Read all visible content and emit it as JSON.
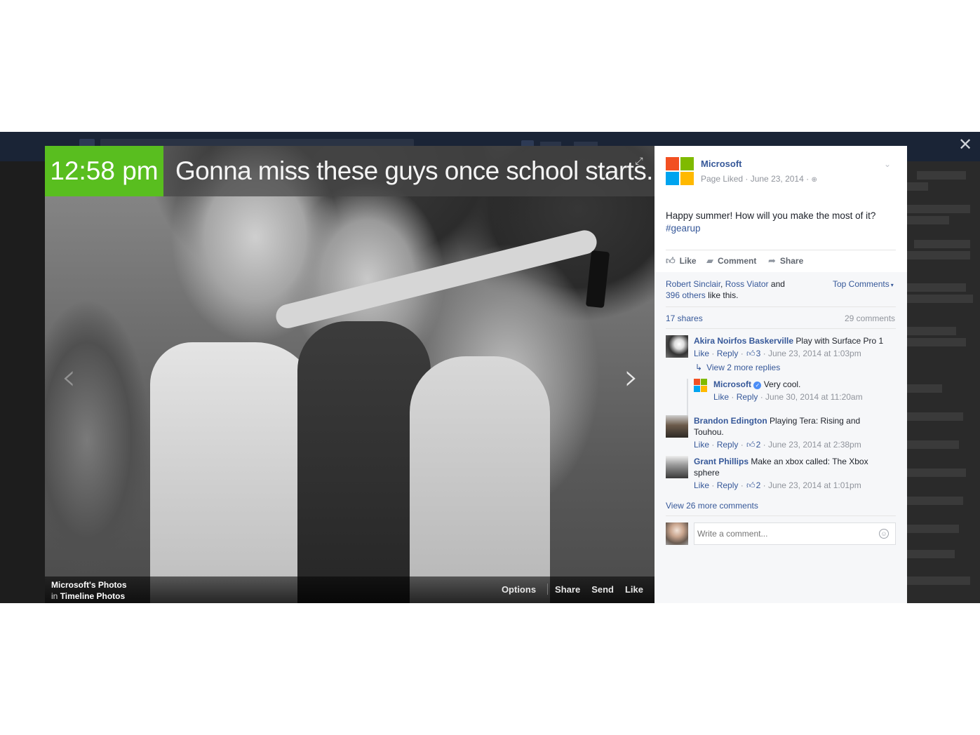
{
  "photo": {
    "time": "12:58 pm",
    "caption": "Gonna miss these guys once school starts.",
    "source_owner": "Microsoft's Photos",
    "source_in": "in",
    "source_album": "Timeline Photos",
    "actions": {
      "options": "Options",
      "share": "Share",
      "send": "Send",
      "like": "Like"
    }
  },
  "close_glyph": "✕",
  "post": {
    "page_name": "Microsoft",
    "meta": "Page Liked · June 23, 2014 ·",
    "text": "Happy summer! How will you make the most of it?",
    "hashtag": "#gearup",
    "actions": {
      "like": "Like",
      "comment": "Comment",
      "share": "Share"
    },
    "likers_1": "Robert Sinclair",
    "likers_sep": ",",
    "likers_2": "Ross Viator",
    "likers_and": "and",
    "likers_others": "396 others",
    "likers_tail": "like this.",
    "top_comments": "Top Comments",
    "shares": "17 shares",
    "comments_count": "29 comments",
    "logo_colors": [
      "#f25022",
      "#7fba00",
      "#00a4ef",
      "#ffb900"
    ]
  },
  "comments": [
    {
      "author": "Akira Noirfos Baskerville",
      "text": "Play with Surface Pro 1",
      "like": "Like",
      "reply": "Reply",
      "likes": "3",
      "date": "June 23, 2014 at 1:03pm",
      "view_replies": "View 2 more replies",
      "reply_item": {
        "author": "Microsoft",
        "text": "Very cool.",
        "like": "Like",
        "reply": "Reply",
        "date": "June 30, 2014 at 11:20am"
      }
    },
    {
      "author": "Brandon Edington",
      "text_line1": "Playing Tera: Rising and",
      "text_line2": "Touhou.",
      "like": "Like",
      "reply": "Reply",
      "likes": "2",
      "date": "June 23, 2014 at 2:38pm"
    },
    {
      "author": "Grant Phillips",
      "text_line1": "Make an xbox called: The Xbox",
      "text_line2": "sphere",
      "like": "Like",
      "reply": "Reply",
      "likes": "2",
      "date": "June 23, 2014 at 1:01pm"
    }
  ],
  "view_more_comments": "View 26 more comments",
  "write_comment_placeholder": "Write a comment..."
}
